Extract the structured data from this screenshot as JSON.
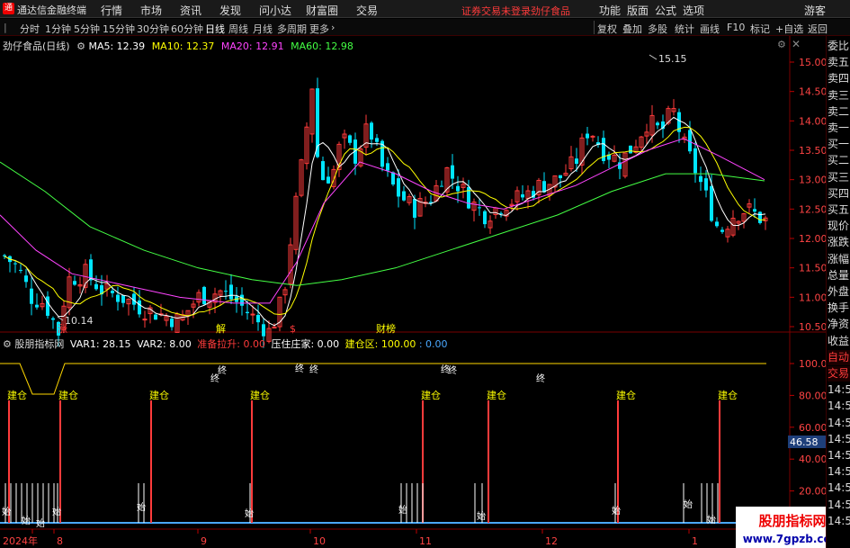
{
  "menubar": {
    "app_title": "通达信金融终端",
    "items": [
      "行情",
      "市场",
      "资讯",
      "发现",
      "问小达",
      "财富圈",
      "交易"
    ],
    "notice": "证券交易未登录",
    "stock_title": "劲仔食品",
    "right_items": [
      "功能",
      "版面",
      "公式",
      "选项"
    ],
    "guest": "游客"
  },
  "toolbar": {
    "periods": [
      "分时",
      "1分钟",
      "5分钟",
      "15分钟",
      "30分钟",
      "60分钟",
      "日线",
      "周线",
      "月线",
      "多周期",
      "更多"
    ],
    "active_period": "日线",
    "right_buttons": [
      "复权",
      "叠加",
      "多股",
      "统计",
      "画线",
      "F10",
      "标记",
      "+自选",
      "返回"
    ]
  },
  "price_panel": {
    "title": "劲仔食品(日线)",
    "ma": [
      {
        "label": "MA5: 12.39",
        "color": "#ffffff"
      },
      {
        "label": "MA10: 12.37",
        "color": "#ffff00"
      },
      {
        "label": "MA20: 12.91",
        "color": "#ff44ff"
      },
      {
        "label": "MA60: 12.98",
        "color": "#44ff44"
      }
    ],
    "y_axis": [
      "15.00",
      "14.50",
      "14.00",
      "13.50",
      "13.00",
      "12.50",
      "12.00",
      "11.50",
      "11.00",
      "10.50"
    ],
    "high_label": "15.15",
    "low_label": "10.14",
    "markers": [
      {
        "text": "涨",
        "color": "#ff3b3b"
      },
      {
        "text": "解",
        "color": "#ffff00"
      },
      {
        "text": "$",
        "color": "#ff3b3b"
      },
      {
        "text": "财榜",
        "color": "#ffff00"
      }
    ]
  },
  "indicator_panel": {
    "name": "股朋指标网",
    "values": [
      {
        "label": "VAR1: 28.15",
        "color": "#ffffff"
      },
      {
        "label": "VAR2: 8.00",
        "color": "#ffffff"
      },
      {
        "label": "准备拉升: 0.00",
        "color": "#ff3b3b"
      },
      {
        "label": "压住庄家: 0.00",
        "color": "#ffffff"
      },
      {
        "label": "建仓区: 100.00",
        "color": "#ffff00"
      },
      {
        "label": ": 0.00",
        "color": "#4aa8ff"
      }
    ],
    "y_axis": [
      "100.00",
      "80.00",
      "60.00",
      "40.00",
      "20.00"
    ],
    "current_value": "46.58",
    "build_label": "建仓",
    "end_label": "终",
    "start_label": "始"
  },
  "x_axis": [
    "2024年",
    "8",
    "9",
    "10",
    "11",
    "12",
    "1"
  ],
  "right_panel": [
    "委比",
    "卖五",
    "卖四",
    "卖三",
    "卖二",
    "卖一",
    "买一",
    "买二",
    "买三",
    "买四",
    "买五",
    "现价",
    "涨跌",
    "涨幅",
    "总量",
    "外盘",
    "换手",
    "净资",
    "收益",
    "自动",
    "交易",
    "14:56",
    "14:56",
    "14:56",
    "14:56",
    "14:56",
    "14:56",
    "14:56",
    "14:56",
    "14:56"
  ],
  "watermark": {
    "title": "股朋指标网",
    "url": "www.7gpzb.com"
  },
  "colors": {
    "up": "#ff3b3b",
    "down": "#00e5ff",
    "ma5": "#ffffff",
    "ma10": "#ffff00",
    "ma20": "#ff44ff",
    "ma60": "#44ff44"
  }
}
